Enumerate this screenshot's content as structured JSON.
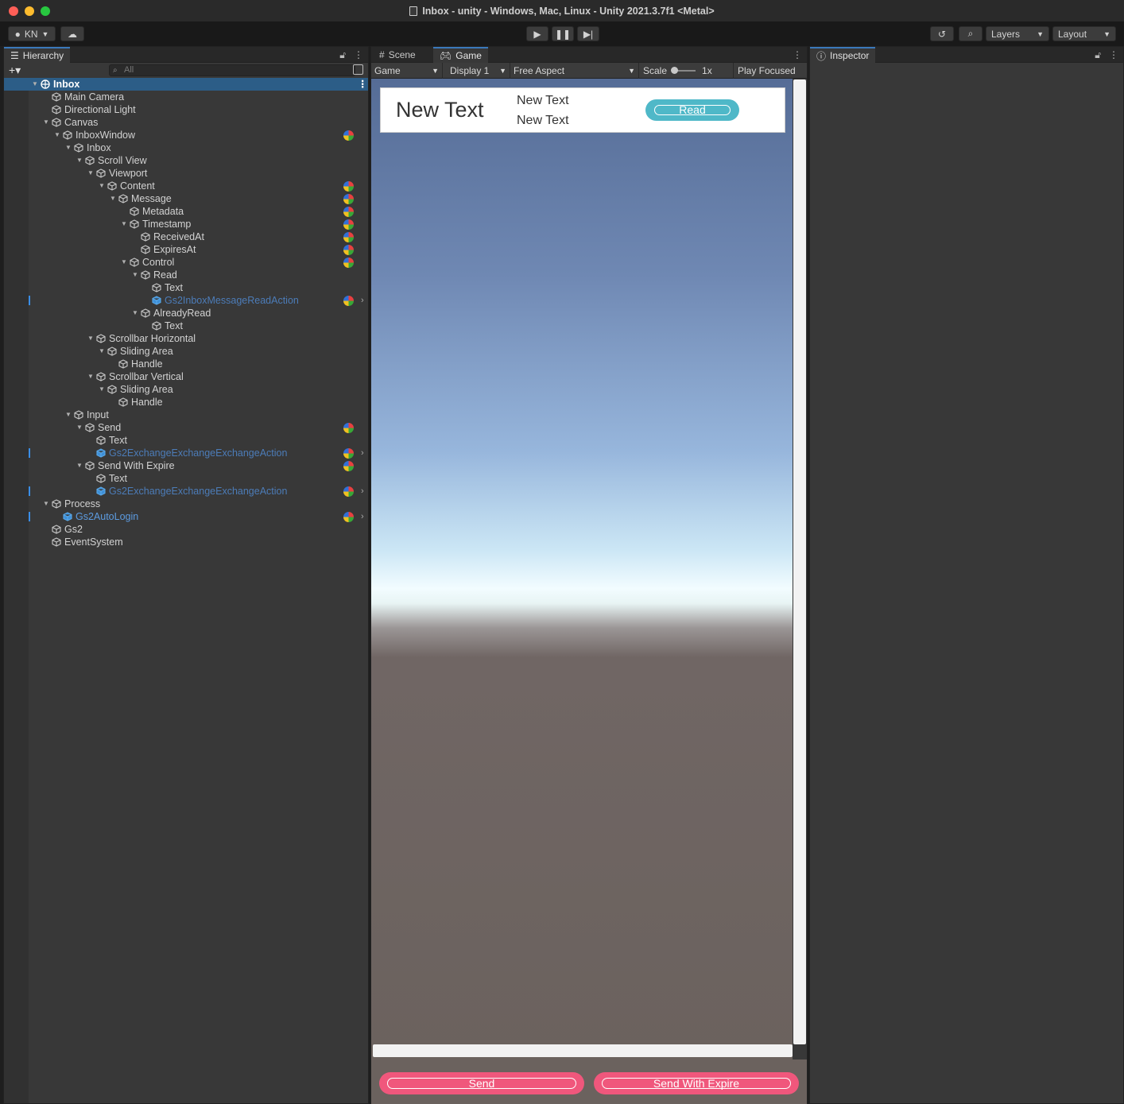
{
  "window": {
    "title": "Inbox - unity - Windows, Mac, Linux - Unity 2021.3.7f1 <Metal>"
  },
  "toolbar": {
    "account": "KN",
    "layers": "Layers",
    "layout": "Layout"
  },
  "hierarchy": {
    "tab": "Hierarchy",
    "search_placeholder": "All",
    "items": [
      {
        "label": "Inbox",
        "depth": 0,
        "expanded": true,
        "selected": true,
        "kind": "scene"
      },
      {
        "label": "Main Camera",
        "depth": 1
      },
      {
        "label": "Directional Light",
        "depth": 1
      },
      {
        "label": "Canvas",
        "depth": 1,
        "expanded": true
      },
      {
        "label": "InboxWindow",
        "depth": 2,
        "expanded": true,
        "component": true
      },
      {
        "label": "Inbox",
        "depth": 3,
        "expanded": true
      },
      {
        "label": "Scroll View",
        "depth": 4,
        "expanded": true
      },
      {
        "label": "Viewport",
        "depth": 5,
        "expanded": true
      },
      {
        "label": "Content",
        "depth": 6,
        "expanded": true,
        "component": true
      },
      {
        "label": "Message",
        "depth": 7,
        "expanded": true,
        "component": true
      },
      {
        "label": "Metadata",
        "depth": 8,
        "component": true
      },
      {
        "label": "Timestamp",
        "depth": 8,
        "expanded": true,
        "component": true
      },
      {
        "label": "ReceivedAt",
        "depth": 9,
        "component": true
      },
      {
        "label": "ExpiresAt",
        "depth": 9,
        "component": true
      },
      {
        "label": "Control",
        "depth": 8,
        "expanded": true,
        "component": true
      },
      {
        "label": "Read",
        "depth": 9,
        "expanded": true
      },
      {
        "label": "Text",
        "depth": 10
      },
      {
        "label": "Gs2InboxMessageReadAction",
        "depth": 10,
        "kind": "prefab-dim",
        "component": true,
        "chevron": true,
        "marker": true
      },
      {
        "label": "AlreadyRead",
        "depth": 9,
        "expanded": true
      },
      {
        "label": "Text",
        "depth": 10
      },
      {
        "label": "Scrollbar Horizontal",
        "depth": 5,
        "expanded": true
      },
      {
        "label": "Sliding Area",
        "depth": 6,
        "expanded": true
      },
      {
        "label": "Handle",
        "depth": 7
      },
      {
        "label": "Scrollbar Vertical",
        "depth": 5,
        "expanded": true
      },
      {
        "label": "Sliding Area",
        "depth": 6,
        "expanded": true
      },
      {
        "label": "Handle",
        "depth": 7
      },
      {
        "label": "Input",
        "depth": 3,
        "expanded": true
      },
      {
        "label": "Send",
        "depth": 4,
        "expanded": true,
        "component": true
      },
      {
        "label": "Text",
        "depth": 5
      },
      {
        "label": "Gs2ExchangeExchangeExchangeAction",
        "depth": 5,
        "kind": "prefab-dim",
        "component": true,
        "chevron": true,
        "marker": true
      },
      {
        "label": "Send With Expire",
        "depth": 4,
        "expanded": true,
        "component": true
      },
      {
        "label": "Text",
        "depth": 5
      },
      {
        "label": "Gs2ExchangeExchangeExchangeAction",
        "depth": 5,
        "kind": "prefab-dim",
        "component": true,
        "chevron": true,
        "marker": true
      },
      {
        "label": "Process",
        "depth": 1,
        "expanded": true
      },
      {
        "label": "Gs2AutoLogin",
        "depth": 2,
        "kind": "prefab",
        "component": true,
        "chevron": true,
        "marker": true
      },
      {
        "label": "Gs2",
        "depth": 1
      },
      {
        "label": "EventSystem",
        "depth": 1
      }
    ]
  },
  "game_view": {
    "tabs": {
      "scene": "Scene",
      "game": "Game"
    },
    "controls": {
      "mode": "Game",
      "display": "Display 1",
      "aspect": "Free Aspect",
      "scale_label": "Scale",
      "scale_value": "1x",
      "play_mode": "Play Focused"
    },
    "message": {
      "title": "New Text",
      "received": "New Text",
      "expires": "New Text",
      "read_button": "Read"
    },
    "send_button": "Send",
    "send_expire_button": "Send With Expire",
    "colors": {
      "read": "#4fb8c8",
      "send": "#f0577c"
    }
  },
  "inspector": {
    "tab": "Inspector"
  }
}
